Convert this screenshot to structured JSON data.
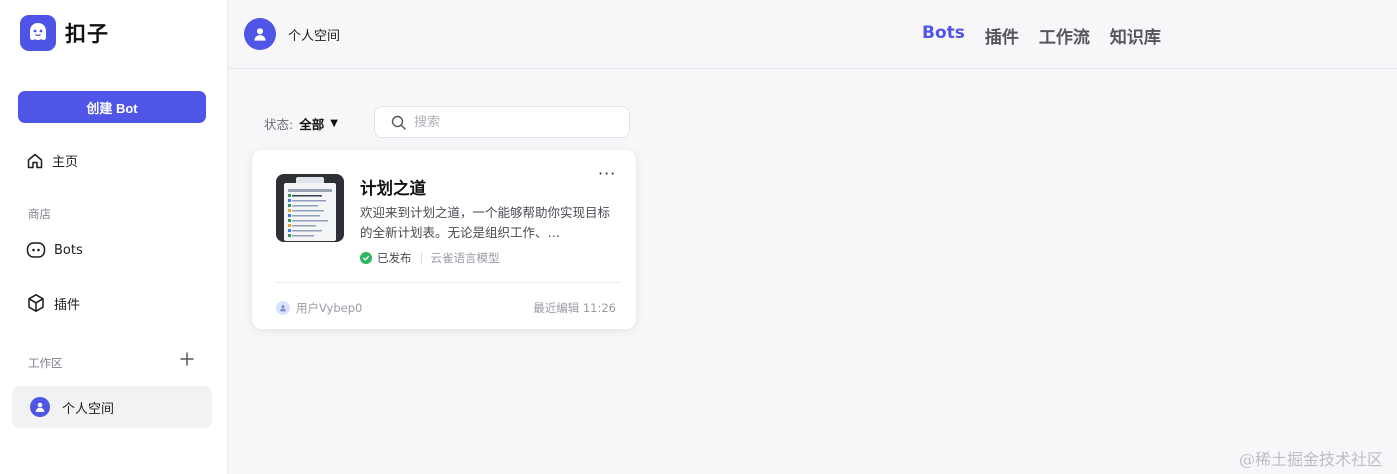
{
  "app": {
    "name": "扣子",
    "accent": "#4f55e6"
  },
  "sidebar": {
    "create_button": "创建 Bot",
    "home": {
      "label": "主页",
      "icon": "home-icon"
    },
    "store_section": "商店",
    "store_items": [
      {
        "label": "Bots",
        "icon": "bot-icon"
      },
      {
        "label": "插件",
        "icon": "cube-icon"
      }
    ],
    "workspace_section": "工作区",
    "workspace_item": "个人空间"
  },
  "header": {
    "space_name": "个人空间",
    "tabs": [
      {
        "label": "Bots",
        "active": true
      },
      {
        "label": "插件",
        "active": false
      },
      {
        "label": "工作流",
        "active": false
      },
      {
        "label": "知识库",
        "active": false
      }
    ]
  },
  "filters": {
    "status_label": "状态:",
    "status_value": "全部",
    "search_placeholder": "搜索"
  },
  "bot_card": {
    "title": "计划之道",
    "description": "欢迎来到计划之道，一个能够帮助你实现目标的全新计划表。无论是组织工作、…",
    "status": "已发布",
    "model": "云雀语言模型",
    "owner": "用户Vybep0",
    "edited": "最近编辑 11:26"
  },
  "watermark": "@稀土掘金技术社区"
}
